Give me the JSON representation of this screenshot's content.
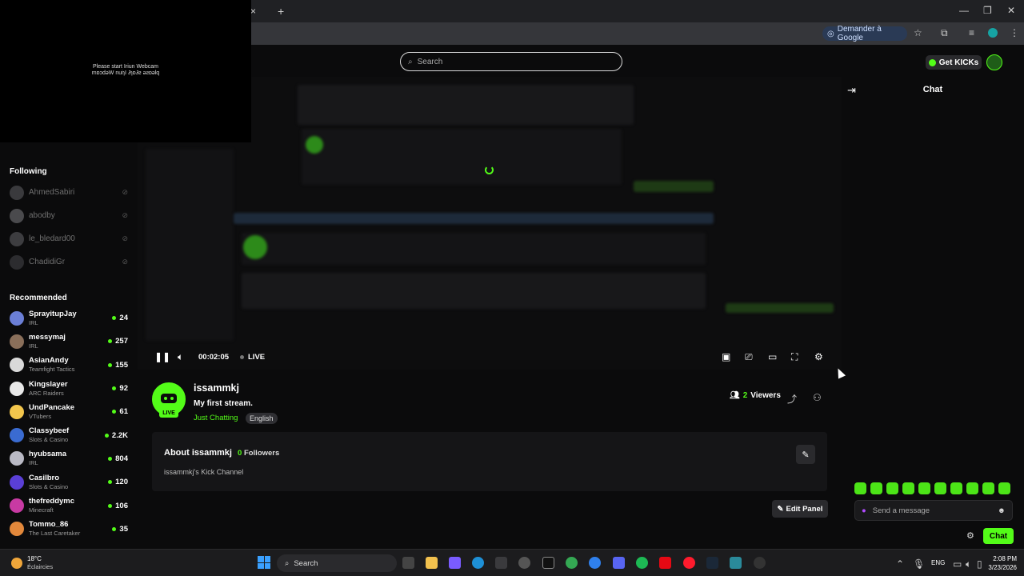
{
  "browser": {
    "new_tab": "+",
    "close_tab": "×",
    "google_chip": "Demander à Google"
  },
  "webcam": {
    "line1": "Please start Iriun Webcam",
    "line2": "mɒɔdəW nuiɿI ɈɿɒɈƨ əƨɒəlq"
  },
  "header": {
    "search_placeholder": "Search",
    "get_kicks": "Get KICKs"
  },
  "sidebar": {
    "following_title": "Following",
    "following": [
      {
        "name": "AhmedSabiri"
      },
      {
        "name": "abodby"
      },
      {
        "name": "le_bledard00"
      },
      {
        "name": "ChadidiGr"
      }
    ],
    "recommended_title": "Recommended",
    "recommended": [
      {
        "name": "SprayitupJay",
        "category": "IRL",
        "viewers": "24",
        "color": "#6b7fd6"
      },
      {
        "name": "messymaj",
        "category": "IRL",
        "viewers": "257",
        "color": "#8a6f5a"
      },
      {
        "name": "AsianAndy",
        "category": "Teamfight Tactics",
        "viewers": "155",
        "color": "#d9d9d9"
      },
      {
        "name": "Kingslayer",
        "category": "ARC Raiders",
        "viewers": "92",
        "color": "#e9e9e9"
      },
      {
        "name": "UndPancake",
        "category": "VTubers",
        "viewers": "61",
        "color": "#f3c64c"
      },
      {
        "name": "Classybeef",
        "category": "Slots & Casino",
        "viewers": "2.2K",
        "color": "#3a6bd1"
      },
      {
        "name": "hyubsama",
        "category": "IRL",
        "viewers": "804",
        "color": "#b9b9c4"
      },
      {
        "name": "Casilbro",
        "category": "Slots & Casino",
        "viewers": "120",
        "color": "#5a3fd6"
      },
      {
        "name": "thefreddymc",
        "category": "Minecraft",
        "viewers": "106",
        "color": "#c83aa3"
      },
      {
        "name": "Tommo_86",
        "category": "The Last Caretaker",
        "viewers": "35",
        "color": "#e2883b"
      }
    ]
  },
  "player": {
    "time": "00:02:05",
    "live": "LIVE"
  },
  "channel": {
    "name": "issammkj",
    "live_badge": "LIVE",
    "stream_title": "My first stream.",
    "category": "Just Chatting",
    "language": "English",
    "viewers_count": "2",
    "viewers_label": "Viewers"
  },
  "about": {
    "title": "About issammkj",
    "followers_count": "0",
    "followers_label": "Followers",
    "description": "issammkj's Kick Channel",
    "edit_panel": "Edit Panel"
  },
  "chat": {
    "title": "Chat",
    "input_placeholder": "Send a message",
    "send_button": "Chat"
  },
  "taskbar": {
    "temp": "18°C",
    "weather": "Éclaircies",
    "search": "Search",
    "lang": "ENG",
    "time": "2:08 PM",
    "date": "3/23/2026"
  },
  "colors": {
    "accent": "#53fc18",
    "background": "#0b0b0c"
  }
}
